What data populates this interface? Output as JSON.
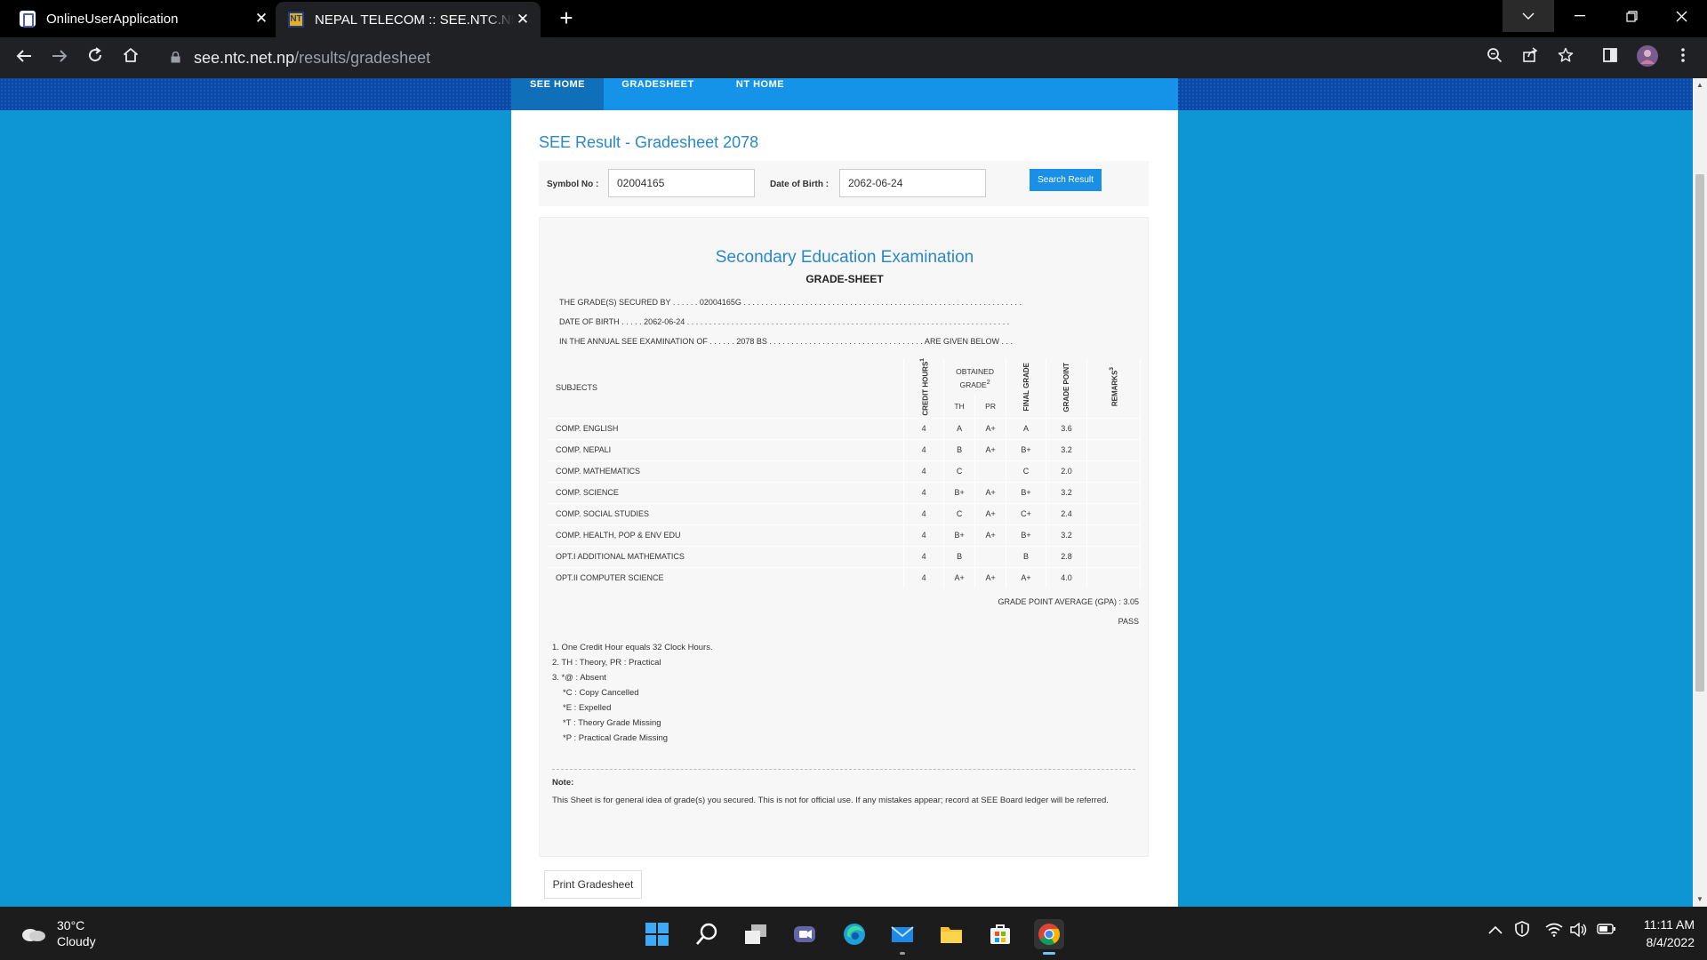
{
  "browser": {
    "tabs": [
      {
        "title": "OnlineUserApplication"
      },
      {
        "title": "NEPAL TELECOM :: SEE.NTC.NET.NP"
      }
    ],
    "url_domain": "see.ntc.net.np",
    "url_path": "/results/gradesheet"
  },
  "site_nav": {
    "items": [
      "SEE HOME",
      "GRADESHEET",
      "NT HOME"
    ]
  },
  "page": {
    "title": "SEE Result - Gradesheet 2078",
    "search": {
      "symbol_label": "Symbol No :",
      "symbol_value": "02004165",
      "dob_label": "Date of Birth :",
      "dob_value": "2062-06-24",
      "button_label": "Search Result"
    },
    "sheet": {
      "exam_title": "Secondary Education Examination",
      "gs_title": "GRADE-SHEET",
      "line1": "THE GRADE(S) SECURED BY . . . . . . 02004165G . . . . . . . . . . . . . . . . . . . . . . . . . . . . . . . . . . . . . . . . . . . . . . . . . . . . . . . . . . . . . . .",
      "line2": "DATE OF BIRTH . . . . . 2062-06-24 . . . . . . . . . . . . . . . . . . . . . . . . . . . . . . . . . . . . . . . . . . . . . . . . . . . . . . . . . . . . . . . . . . . . . . . . .",
      "line3": "IN THE ANNUAL SEE EXAMINATION OF . . . . . . 2078 BS . . . . . . . . . . . . . . . . . . . . . . . . . . . . . . . . . . . ARE GIVEN BELOW . . .",
      "headers": {
        "subjects": "SUBJECTS",
        "credit": "CREDIT HOURS",
        "credit_sup": "1",
        "obtained": "OBTAINED GRADE",
        "obtained_sup": "2",
        "th": "TH",
        "pr": "PR",
        "final": "FINAL GRADE",
        "point": "GRADE POINT",
        "remarks": "REMARKS",
        "remarks_sup": "3"
      },
      "rows": [
        {
          "subject": "COMP. ENGLISH",
          "credit": "4",
          "th": "A",
          "pr": "A+",
          "final": "A",
          "point": "3.6",
          "remarks": ""
        },
        {
          "subject": "COMP. NEPALI",
          "credit": "4",
          "th": "B",
          "pr": "A+",
          "final": "B+",
          "point": "3.2",
          "remarks": ""
        },
        {
          "subject": "COMP. MATHEMATICS",
          "credit": "4",
          "th": "C",
          "pr": "",
          "final": "C",
          "point": "2.0",
          "remarks": ""
        },
        {
          "subject": "COMP. SCIENCE",
          "credit": "4",
          "th": "B+",
          "pr": "A+",
          "final": "B+",
          "point": "3.2",
          "remarks": ""
        },
        {
          "subject": "COMP. SOCIAL STUDIES",
          "credit": "4",
          "th": "C",
          "pr": "A+",
          "final": "C+",
          "point": "2.4",
          "remarks": ""
        },
        {
          "subject": "COMP. HEALTH, POP & ENV EDU",
          "credit": "4",
          "th": "B+",
          "pr": "A+",
          "final": "B+",
          "point": "3.2",
          "remarks": ""
        },
        {
          "subject": "OPT.I ADDITIONAL MATHEMATICS",
          "credit": "4",
          "th": "B",
          "pr": "",
          "final": "B",
          "point": "2.8",
          "remarks": ""
        },
        {
          "subject": "OPT.II COMPUTER SCIENCE",
          "credit": "4",
          "th": "A+",
          "pr": "A+",
          "final": "A+",
          "point": "4.0",
          "remarks": ""
        }
      ],
      "gpa_label": "GRADE POINT AVERAGE (GPA) : 3.05",
      "result": "PASS",
      "footnotes": [
        "1. One Credit Hour equals 32 Clock Hours.",
        "2. TH : Theory, PR : Practical",
        "3. *@ : Absent",
        "*C : Copy Cancelled",
        "*E : Expelled",
        "*T : Theory Grade Missing",
        "*P : Practical Grade Missing"
      ],
      "note_head": "Note:",
      "note_text": "This Sheet is for general idea of grade(s) you secured. This is not for official use. If any mistakes appear; record at SEE Board ledger will be referred."
    },
    "print_label": "Print Gradesheet"
  },
  "taskbar": {
    "temperature": "30°C",
    "condition": "Cloudy",
    "time": "11:11 AM",
    "date": "8/4/2022"
  }
}
